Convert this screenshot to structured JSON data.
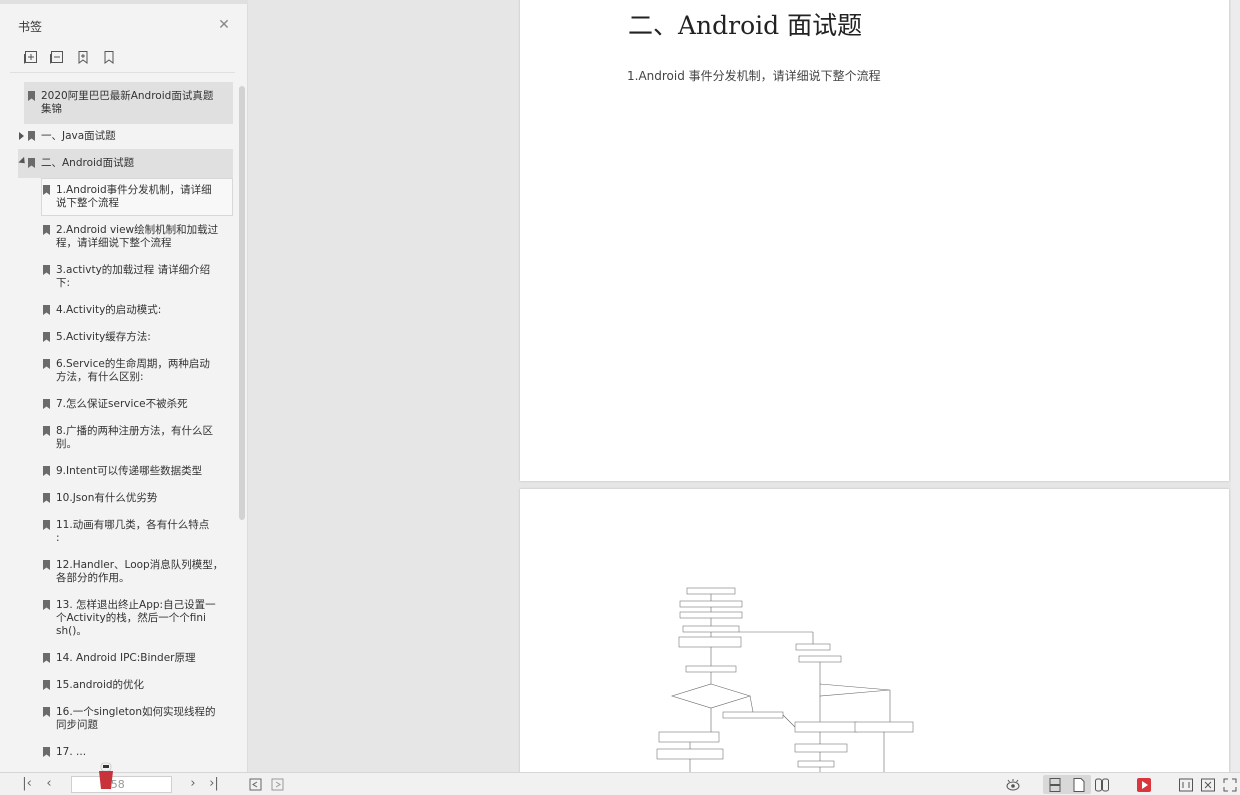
{
  "sidebar": {
    "title": "书签",
    "close_icon": "close-icon",
    "tools": [
      "expand-all-icon",
      "collapse-all-icon",
      "add-bookmark-icon",
      "bookmark-icon"
    ],
    "items": [
      {
        "label_lines": [
          "2020阿里巴巴最新Android面试真题",
          "集锦"
        ],
        "level": 0,
        "expander": "none",
        "highlight": true
      },
      {
        "label_lines": [
          "一、Java面试题"
        ],
        "level": 0,
        "expander": "collapsed",
        "highlight": false
      },
      {
        "label_lines": [
          "二、Android面试题"
        ],
        "level": 0,
        "expander": "expanded",
        "highlight": true
      },
      {
        "label_lines": [
          "1.Android事件分发机制，请详细",
          "说下整个流程"
        ],
        "level": 1,
        "selected": true
      },
      {
        "label_lines": [
          "2.Android view绘制机制和加载过",
          "程，请详细说下整个流程"
        ],
        "level": 1
      },
      {
        "label_lines": [
          "3.activty的加载过程 请详细介绍",
          "下:"
        ],
        "level": 1
      },
      {
        "label_lines": [
          "4.Activity的启动模式:"
        ],
        "level": 1
      },
      {
        "label_lines": [
          "5.Activity缓存方法:"
        ],
        "level": 1
      },
      {
        "label_lines": [
          "6.Service的生命周期，两种启动",
          "方法，有什么区别:"
        ],
        "level": 1
      },
      {
        "label_lines": [
          "7.怎么保证service不被杀死"
        ],
        "level": 1
      },
      {
        "label_lines": [
          "8.广播的两种注册方法，有什么区",
          "别。"
        ],
        "level": 1
      },
      {
        "label_lines": [
          "9.Intent可以传递哪些数据类型"
        ],
        "level": 1
      },
      {
        "label_lines": [
          "10.Json有什么优劣势"
        ],
        "level": 1
      },
      {
        "label_lines": [
          "11.动画有哪几类，各有什么特点",
          ":"
        ],
        "level": 1
      },
      {
        "label_lines": [
          "12.Handler、Loop消息队列模型，",
          "各部分的作用。"
        ],
        "level": 1
      },
      {
        "label_lines": [
          "13. 怎样退出终止App:自己设置一",
          "个Activity的栈，然后一个个fini",
          "sh()。"
        ],
        "level": 1
      },
      {
        "label_lines": [
          "14. Android IPC:Binder原理"
        ],
        "level": 1
      },
      {
        "label_lines": [
          "15.android的优化"
        ],
        "level": 1
      },
      {
        "label_lines": [
          "16.一个singleton如何实现线程的",
          "同步问题"
        ],
        "level": 1
      },
      {
        "label_lines": [
          "17. ..."
        ],
        "level": 1
      }
    ]
  },
  "document": {
    "heading": "二、Android 面试题",
    "question": "1.Android 事件分发机制，请详细说下整个流程"
  },
  "bottombar": {
    "page_placeholder": "1/58",
    "nav_icons": [
      "first-page-icon",
      "prev-page-icon",
      "next-page-icon",
      "last-page-icon"
    ],
    "right_icons": [
      "eye-icon",
      "single-page-icon",
      "continuous-page-icon",
      "two-page-icon",
      "play-icon",
      "fit-width-icon",
      "fit-page-icon",
      "fullscreen-icon"
    ]
  },
  "colors": {
    "accent_red": "#d9363e",
    "sidebar_bg": "#f3f3f3",
    "highlight": "#e0e0e0"
  }
}
